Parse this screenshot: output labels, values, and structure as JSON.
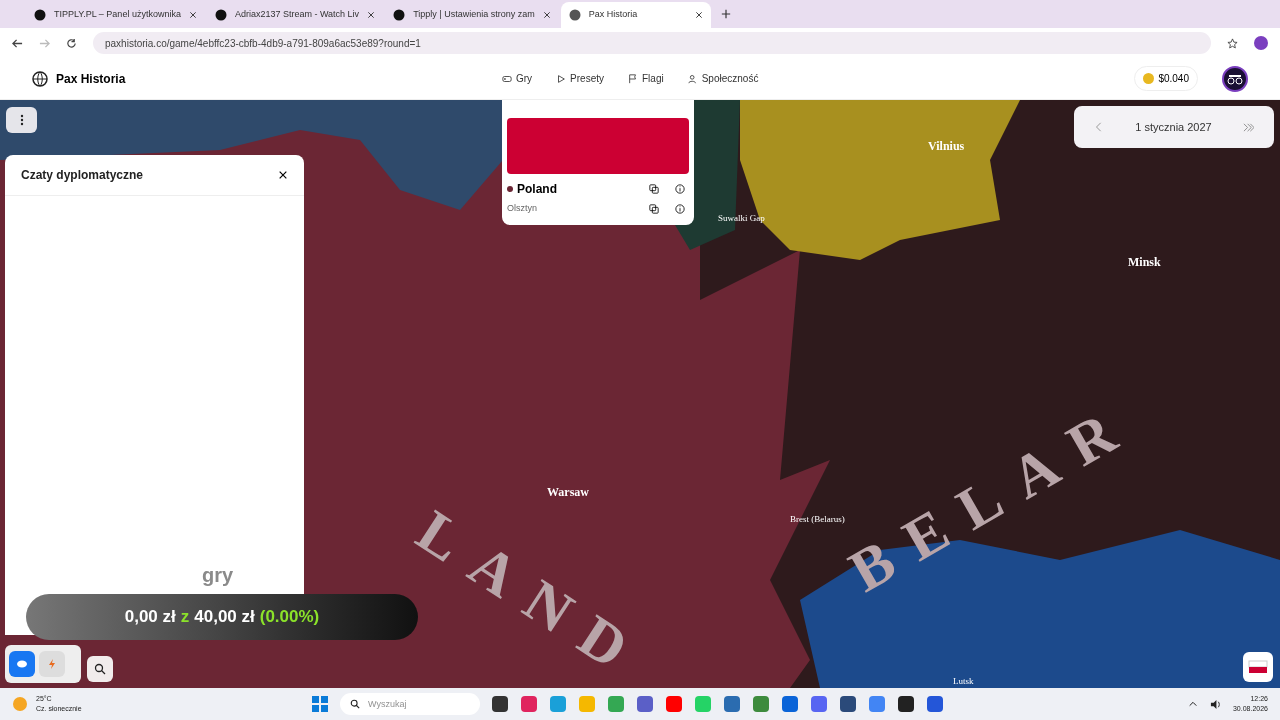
{
  "browser": {
    "tabs": [
      {
        "title": "TIPPLY.PL – Panel użytkownika",
        "selected": false
      },
      {
        "title": "Adriax2137 Stream - Watch Liv",
        "selected": false
      },
      {
        "title": "Tipply | Ustawienia strony zam",
        "selected": false
      },
      {
        "title": "Pax Historia",
        "selected": true
      }
    ],
    "url": "paxhistoria.co/game/4ebffc23-cbfb-4db9-a791-809a6ac53e89?round=1"
  },
  "header": {
    "brand": "Pax Historia",
    "nav": [
      {
        "label": "Gry"
      },
      {
        "label": "Presety"
      },
      {
        "label": "Flagi"
      },
      {
        "label": "Społeczność"
      }
    ],
    "balance": "$0.040"
  },
  "map": {
    "date": "1 stycznia 2027",
    "labels": [
      {
        "text": "Vilnius",
        "kind": "city"
      },
      {
        "text": "Minsk",
        "kind": "city"
      },
      {
        "text": "Suwalki Gap",
        "kind": "region"
      },
      {
        "text": "Warsaw",
        "kind": "city"
      },
      {
        "text": "Brest (Belarus)",
        "kind": "region"
      },
      {
        "text": "Lutsk",
        "kind": "region"
      },
      {
        "text": "LAND",
        "kind": "country"
      },
      {
        "text": "BELAR",
        "kind": "country"
      }
    ]
  },
  "popup": {
    "country": "Poland",
    "city": "Olsztyn"
  },
  "chat_panel": {
    "title": "Czaty dyplomatyczne"
  },
  "overlay": {
    "caption": "gry",
    "raised": "0,00 zł",
    "joiner": "z",
    "goal": "40,00 zł",
    "percent": "(0.00%)"
  },
  "taskbar": {
    "temperature": "25°C",
    "weather": "Cz. słonecznie",
    "search_placeholder": "Wyszukaj",
    "time": "12:26",
    "date": "30.08.2026"
  }
}
